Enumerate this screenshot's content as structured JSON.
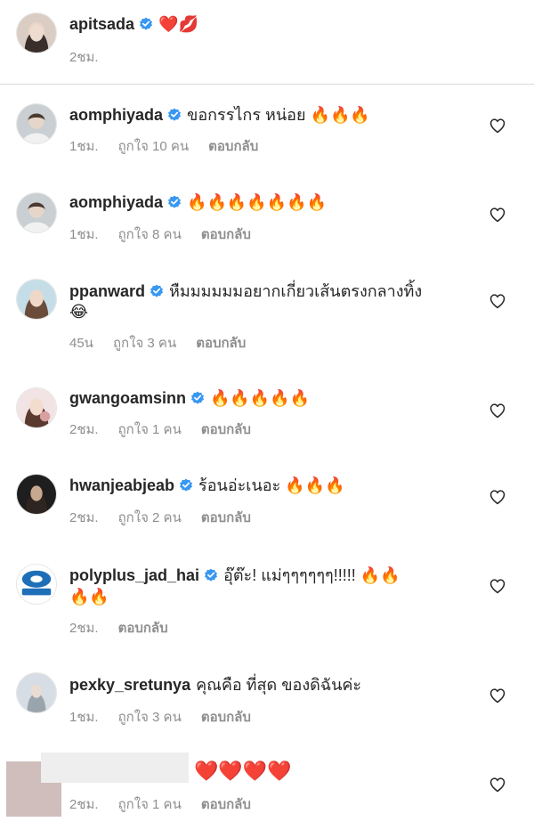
{
  "caption": {
    "username": "apitsada",
    "text": "❤️💋",
    "time": "2ชม."
  },
  "comments": [
    {
      "username": "aomphiyada",
      "text": "ขอกรรไกร หน่อย 🔥🔥🔥",
      "time": "1ชม.",
      "likes": "ถูกใจ 10 คน",
      "reply": "ตอบกลับ",
      "verified": true
    },
    {
      "username": "aomphiyada",
      "text": "🔥🔥🔥🔥🔥🔥🔥",
      "time": "1ชม.",
      "likes": "ถูกใจ 8 คน",
      "reply": "ตอบกลับ",
      "verified": true
    },
    {
      "username": "ppanward",
      "text": "หืมมมมมมอยากเกี่ยวเส้นตรงกลางทิ้ง",
      "text2": "😂",
      "time": "45น",
      "likes": "ถูกใจ 3 คน",
      "reply": "ตอบกลับ",
      "verified": true
    },
    {
      "username": "gwangoamsinn",
      "text": "🔥🔥🔥🔥🔥",
      "time": "2ชม.",
      "likes": "ถูกใจ 1 คน",
      "reply": "ตอบกลับ",
      "verified": true
    },
    {
      "username": "hwanjeabjeab",
      "text": "ร้อนอ่ะเนอะ 🔥🔥🔥",
      "time": "2ชม.",
      "likes": "ถูกใจ 2 คน",
      "reply": "ตอบกลับ",
      "verified": true
    },
    {
      "username": "polyplus_jad_hai",
      "text": "อุ๊ต๊ะ! แม่ๆๆๆๆๆๆ!!!!! 🔥🔥",
      "text2": "🔥🔥",
      "time": "2ชม.",
      "reply": "ตอบกลับ",
      "verified": true
    },
    {
      "username": "pexky_sretunya",
      "text": "คุณคือ ที่สุด ของดิฉันค่ะ",
      "time": "1ชม.",
      "likes": "ถูกใจ 3 คน",
      "reply": "ตอบกลับ",
      "verified": false
    },
    {
      "text": "❤️❤️❤️❤️",
      "time": "2ชม.",
      "likes": "ถูกใจ 1 คน",
      "reply": "ตอบกลับ"
    }
  ],
  "colors": {
    "verified_blue": "#3897f0",
    "meta_gray": "#8e8e8e",
    "text": "#262626"
  },
  "icons": {
    "verified": "verified-badge-icon",
    "like": "heart-outline-icon"
  }
}
